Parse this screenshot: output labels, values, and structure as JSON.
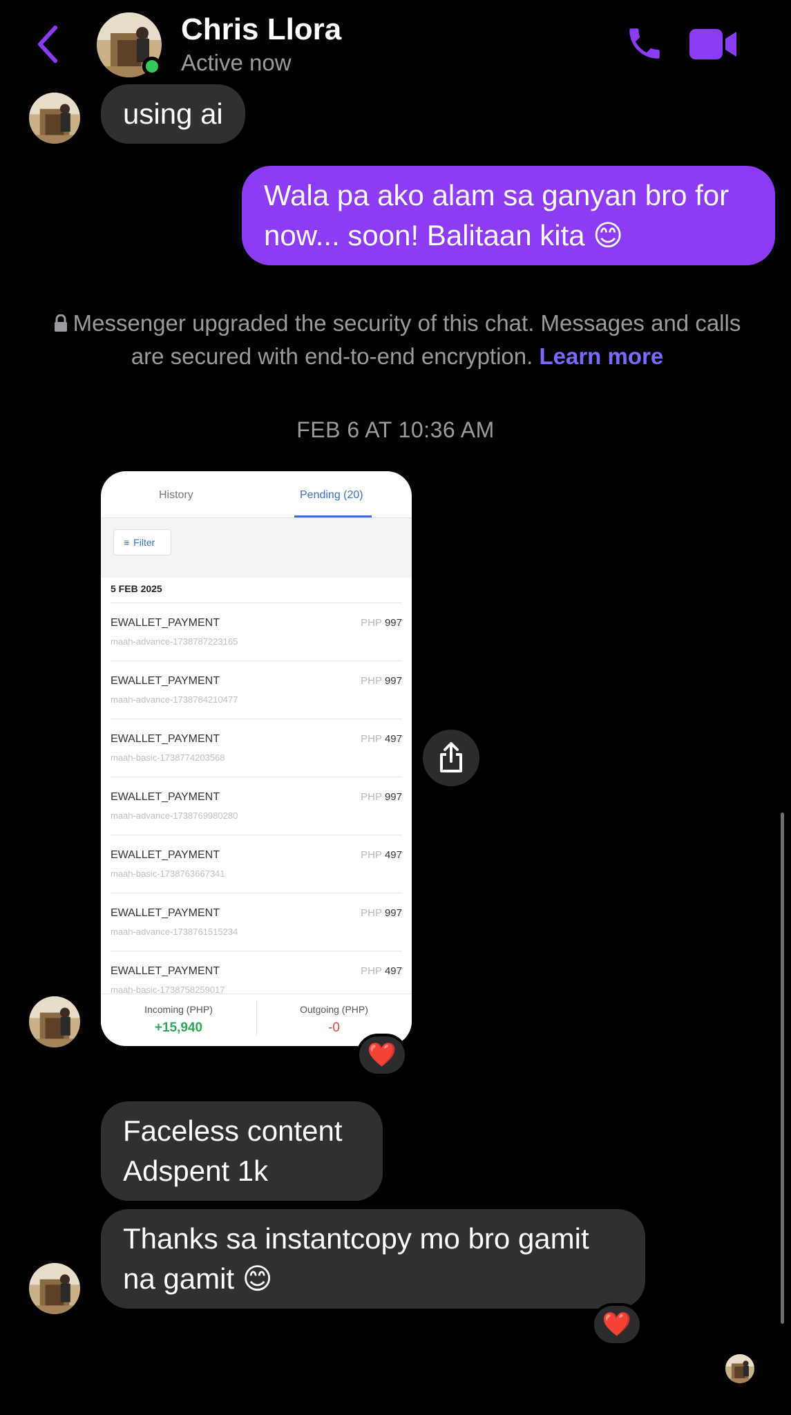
{
  "header": {
    "back_icon": "chevron-left-icon",
    "name": "Chris Llora",
    "status": "Active now",
    "accent_color": "#8c3cf2",
    "online_color": "#35c759",
    "call_icon": "phone-icon",
    "video_icon": "video-camera-icon"
  },
  "messages": [
    {
      "from": "contact",
      "text": "using ai"
    },
    {
      "from": "me",
      "text": "Wala pa ako alam sa ganyan bro for now... soon! Balitaan kita 😊"
    }
  ],
  "security_notice": {
    "text": "Messenger upgraded the security of this chat. Messages and calls are secured with end-to-end encryption.",
    "link": "Learn more"
  },
  "timestamp": "FEB 6 AT 10:36 AM",
  "shared_screenshot": {
    "tabs": [
      {
        "label": "History"
      },
      {
        "label": "Pending (20)"
      }
    ],
    "filter_label": "Filter",
    "date_heading": "5 FEB 2025",
    "currency": "PHP",
    "transactions": [
      {
        "title": "EWALLET_PAYMENT",
        "ref": "maah-advance-1738787223165",
        "amount": "997"
      },
      {
        "title": "EWALLET_PAYMENT",
        "ref": "maah-advance-1738784210477",
        "amount": "997"
      },
      {
        "title": "EWALLET_PAYMENT",
        "ref": "maah-basic-1738774203568",
        "amount": "497"
      },
      {
        "title": "EWALLET_PAYMENT",
        "ref": "maah-advance-1738769980280",
        "amount": "997"
      },
      {
        "title": "EWALLET_PAYMENT",
        "ref": "maah-basic-1738763667341",
        "amount": "497"
      },
      {
        "title": "EWALLET_PAYMENT",
        "ref": "maah-advance-1738761515234",
        "amount": "997"
      },
      {
        "title": "EWALLET_PAYMENT",
        "ref": "maah-basic-1738758259017",
        "amount": "497"
      }
    ],
    "incoming_label": "Incoming (PHP)",
    "incoming_value": "+15,940",
    "outgoing_label": "Outgoing (PHP)",
    "outgoing_value": "-0",
    "reaction": "❤️"
  },
  "later_messages": [
    {
      "from": "contact",
      "text": "Faceless content Adspent 1k"
    },
    {
      "from": "contact",
      "text": "Thanks sa instantcopy mo bro gamit na gamit 😊",
      "reaction": "❤️"
    }
  ],
  "share_icon": "share-icon"
}
